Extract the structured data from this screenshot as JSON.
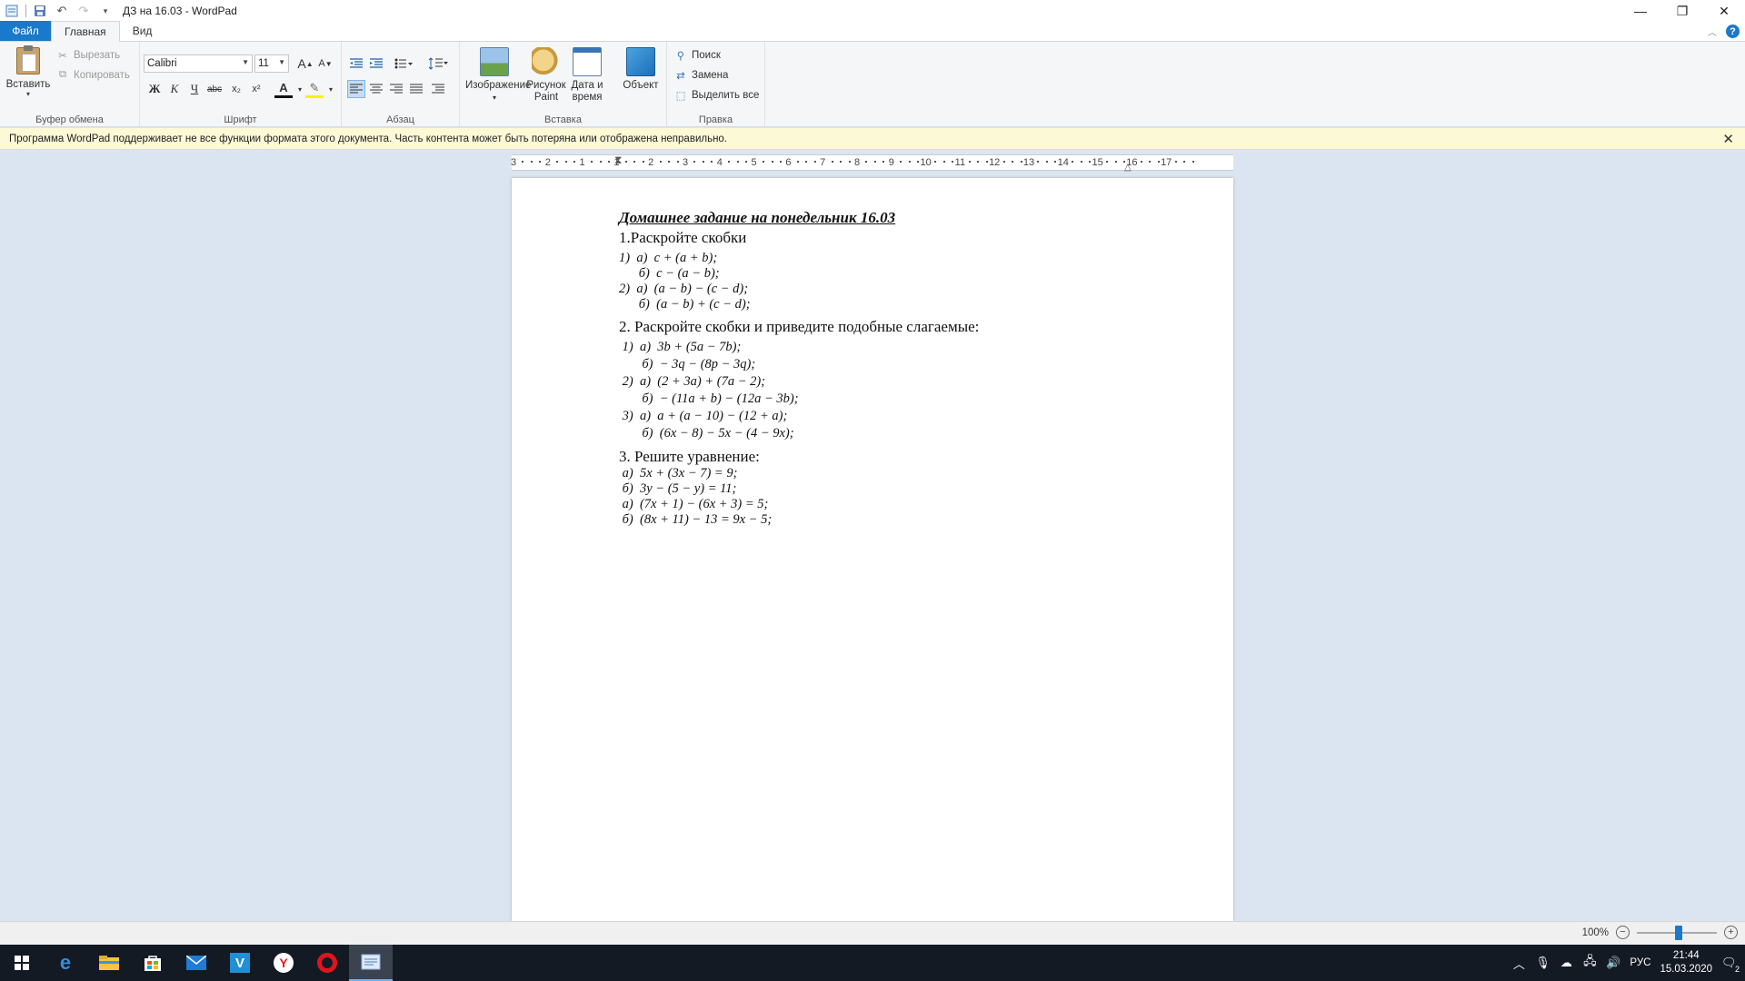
{
  "window": {
    "title": "ДЗ на 16.03 - WordPad",
    "minimize_glyph": "—",
    "maximize_glyph": "❐",
    "close_glyph": "✕"
  },
  "tabs": {
    "file": "Файл",
    "home": "Главная",
    "view": "Вид"
  },
  "clipboard": {
    "paste": "Вставить",
    "cut": "Вырезать",
    "copy": "Копировать",
    "group_label": "Буфер обмена"
  },
  "font": {
    "family": "Calibri",
    "size": "11",
    "group_label": "Шрифт",
    "bold": "Ж",
    "italic": "К",
    "underline": "Ч",
    "strikethrough": "abc",
    "subscript": "x₂",
    "superscript": "x²",
    "grow": "A",
    "shrink": "A",
    "color_letter": "A"
  },
  "paragraph": {
    "group_label": "Абзац"
  },
  "insert": {
    "group_label": "Вставка",
    "image": "Изображение",
    "paint_line1": "Рисунок",
    "paint_line2": "Paint",
    "datetime_line1": "Дата и",
    "datetime_line2": "время",
    "object": "Объект"
  },
  "editing": {
    "group_label": "Правка",
    "find": "Поиск",
    "replace": "Замена",
    "select_all": "Выделить все"
  },
  "infobar": {
    "message": "Программа WordPad поддерживает не все функции формата этого документа. Часть контента может быть потеряна или отображена неправильно."
  },
  "ruler": {
    "labels": [
      "3",
      "2",
      "1",
      "1",
      "2",
      "3",
      "4",
      "5",
      "6",
      "7",
      "8",
      "9",
      "10",
      "11",
      "12",
      "13",
      "14",
      "15",
      "16",
      "17"
    ]
  },
  "document": {
    "heading": "Домашнее задание на понедельник 16.03",
    "section1": "1.Раскройте скобки",
    "section1_lines": [
      "1)  а)  c + (a + b);",
      "      б)  c − (a − b);",
      "2)  а)  (a − b) − (c − d);",
      "      б)  (a − b) + (c − d);"
    ],
    "section2": "2. Раскройте скобки и приведите подобные слагаемые:",
    "section2_lines": [
      " 1)  а)  3b + (5a − 7b);",
      "       б)  − 3q − (8p − 3q);",
      " 2)  а)  (2 + 3a) + (7a − 2);",
      "       б)  − (11a + b) − (12a − 3b);",
      " 3)  а)  a + (a − 10) − (12 + a);",
      "       б)  (6x − 8) − 5x − (4 − 9x);"
    ],
    "section3": "3. Решите уравнение:",
    "section3_lines": [
      " а)  5x + (3x − 7) = 9;",
      " б)  3y − (5 − y) = 11;",
      " а)  (7x + 1) − (6x + 3) = 5;",
      " б)  (8x + 11) − 13 = 9x − 5;"
    ]
  },
  "status": {
    "zoom": "100%",
    "zoom_level_percent": 100
  },
  "taskbar": {
    "language": "РУС",
    "time": "21:44",
    "date": "15.03.2020",
    "notifications": "2"
  }
}
